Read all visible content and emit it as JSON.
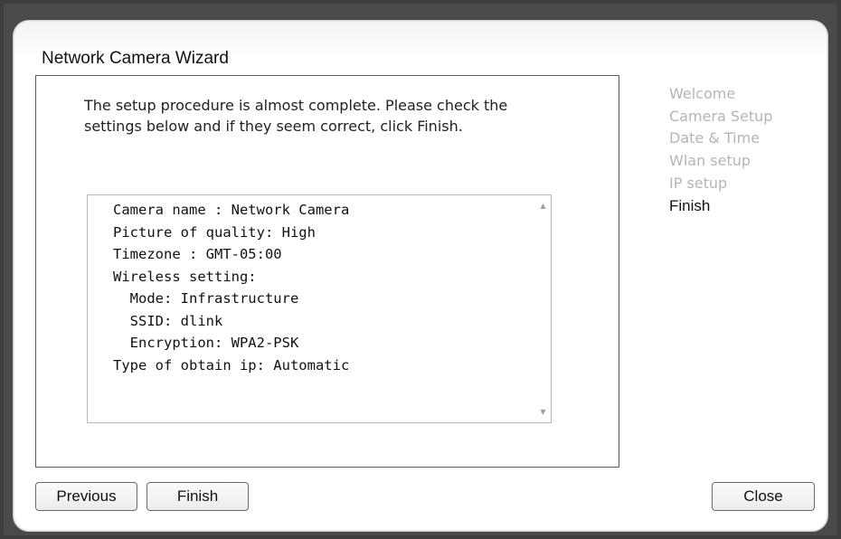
{
  "window": {
    "title": "Network Camera Wizard"
  },
  "main": {
    "intro_text": "The setup procedure is almost complete. Please check the settings below and if they seem correct, click Finish.",
    "summary_lines": [
      "Camera name : Network Camera",
      "Picture of quality: High",
      "Timezone : GMT-05:00",
      "Wireless setting:",
      "  Mode: Infrastructure",
      "  SSID: dlink",
      "  Encryption: WPA2-PSK",
      "Type of obtain ip: Automatic"
    ]
  },
  "steps": {
    "items": [
      {
        "label": "Welcome",
        "active": false
      },
      {
        "label": "Camera Setup",
        "active": false
      },
      {
        "label": "Date & Time",
        "active": false
      },
      {
        "label": "Wlan setup",
        "active": false
      },
      {
        "label": "IP setup",
        "active": false
      },
      {
        "label": "Finish",
        "active": true
      }
    ]
  },
  "buttons": {
    "previous": "Previous",
    "finish": "Finish",
    "close": "Close"
  },
  "icons": {
    "scroll_up": "scroll-up-arrow-icon",
    "scroll_down": "scroll-down-arrow-icon"
  },
  "colors": {
    "inactive_step": "#b5b5b5",
    "active_step": "#111111"
  }
}
